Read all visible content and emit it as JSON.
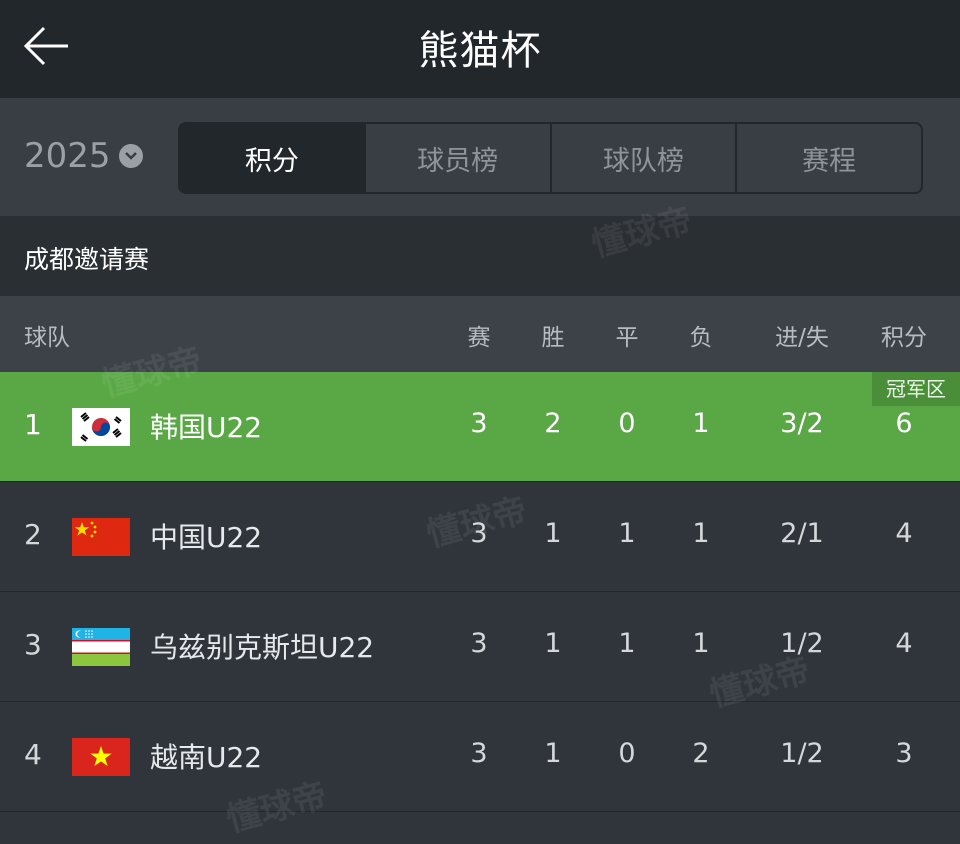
{
  "header": {
    "title": "熊猫杯",
    "back_icon": "arrow-left-icon"
  },
  "year_select": {
    "value": "2025",
    "icon": "chevron-down-circle-icon"
  },
  "tabs": [
    {
      "label": "积分",
      "active": true
    },
    {
      "label": "球员榜",
      "active": false
    },
    {
      "label": "球队榜",
      "active": false
    },
    {
      "label": "赛程",
      "active": false
    }
  ],
  "group": {
    "title": "成都邀请赛"
  },
  "columns": {
    "team": "球队",
    "played": "赛",
    "won": "胜",
    "drawn": "平",
    "lost": "负",
    "goals": "进/失",
    "points": "积分"
  },
  "zone_badge": "冠军区",
  "rows": [
    {
      "rank": "1",
      "flag": "south-korea-flag-icon",
      "team": "韩国U22",
      "played": "3",
      "won": "2",
      "drawn": "0",
      "lost": "1",
      "goals": "3/2",
      "points": "6"
    },
    {
      "rank": "2",
      "flag": "china-flag-icon",
      "team": "中国U22",
      "played": "3",
      "won": "1",
      "drawn": "1",
      "lost": "1",
      "goals": "2/1",
      "points": "4"
    },
    {
      "rank": "3",
      "flag": "uzbekistan-flag-icon",
      "team": "乌兹别克斯坦U22",
      "played": "3",
      "won": "1",
      "drawn": "1",
      "lost": "1",
      "goals": "1/2",
      "points": "4"
    },
    {
      "rank": "4",
      "flag": "vietnam-flag-icon",
      "team": "越南U22",
      "played": "3",
      "won": "1",
      "drawn": "0",
      "lost": "2",
      "goals": "1/2",
      "points": "3"
    }
  ],
  "watermark": "懂球帝",
  "colors": {
    "champion_zone": "#5aa845",
    "header_bg": "#22272b",
    "body_bg": "#2f353b"
  }
}
